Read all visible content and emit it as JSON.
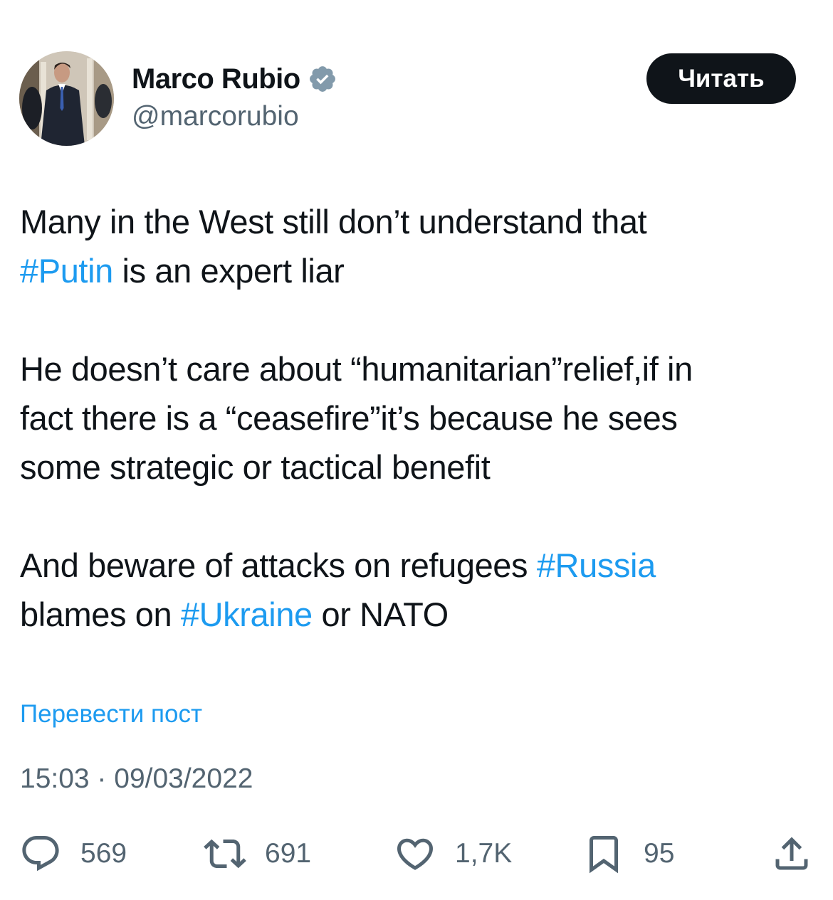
{
  "author": {
    "display_name": "Marco Rubio",
    "handle": "@marcorubio",
    "verified_icon": "verified-badge-icon",
    "avatar": "profile-photo"
  },
  "follow_button": {
    "label": "Читать"
  },
  "tweet": {
    "line1": "Many in the West still don’t understand that",
    "line2_tag": "#Putin",
    "line2_rest": " is an expert liar",
    "para2_line1": "He doesn’t care about “humanitarian”relief,if in",
    "para2_line2": "fact there is a “ceasefire”it’s because he sees",
    "para2_line3": "some strategic or tactical benefit",
    "para3_line1_pre": "And beware of attacks on refugees ",
    "para3_line1_tag": "#Russia",
    "para3_line2_pre": "blames on ",
    "para3_line2_tag": "#Ukraine",
    "para3_line2_post": " or NATO"
  },
  "translate_link": "Перевести пост",
  "timestamp": "15:03 · 09/03/2022",
  "actions": {
    "replies": "569",
    "retweets": "691",
    "likes": "1,7K",
    "bookmarks": "95",
    "reply_icon": "reply-icon",
    "retweet_icon": "retweet-icon",
    "like_icon": "heart-icon",
    "bookmark_icon": "bookmark-icon",
    "share_icon": "share-icon"
  },
  "colors": {
    "text": "#0f1419",
    "secondary": "#536471",
    "accent": "#1d9bf0",
    "button_bg": "#0f1419",
    "button_text": "#ffffff"
  }
}
